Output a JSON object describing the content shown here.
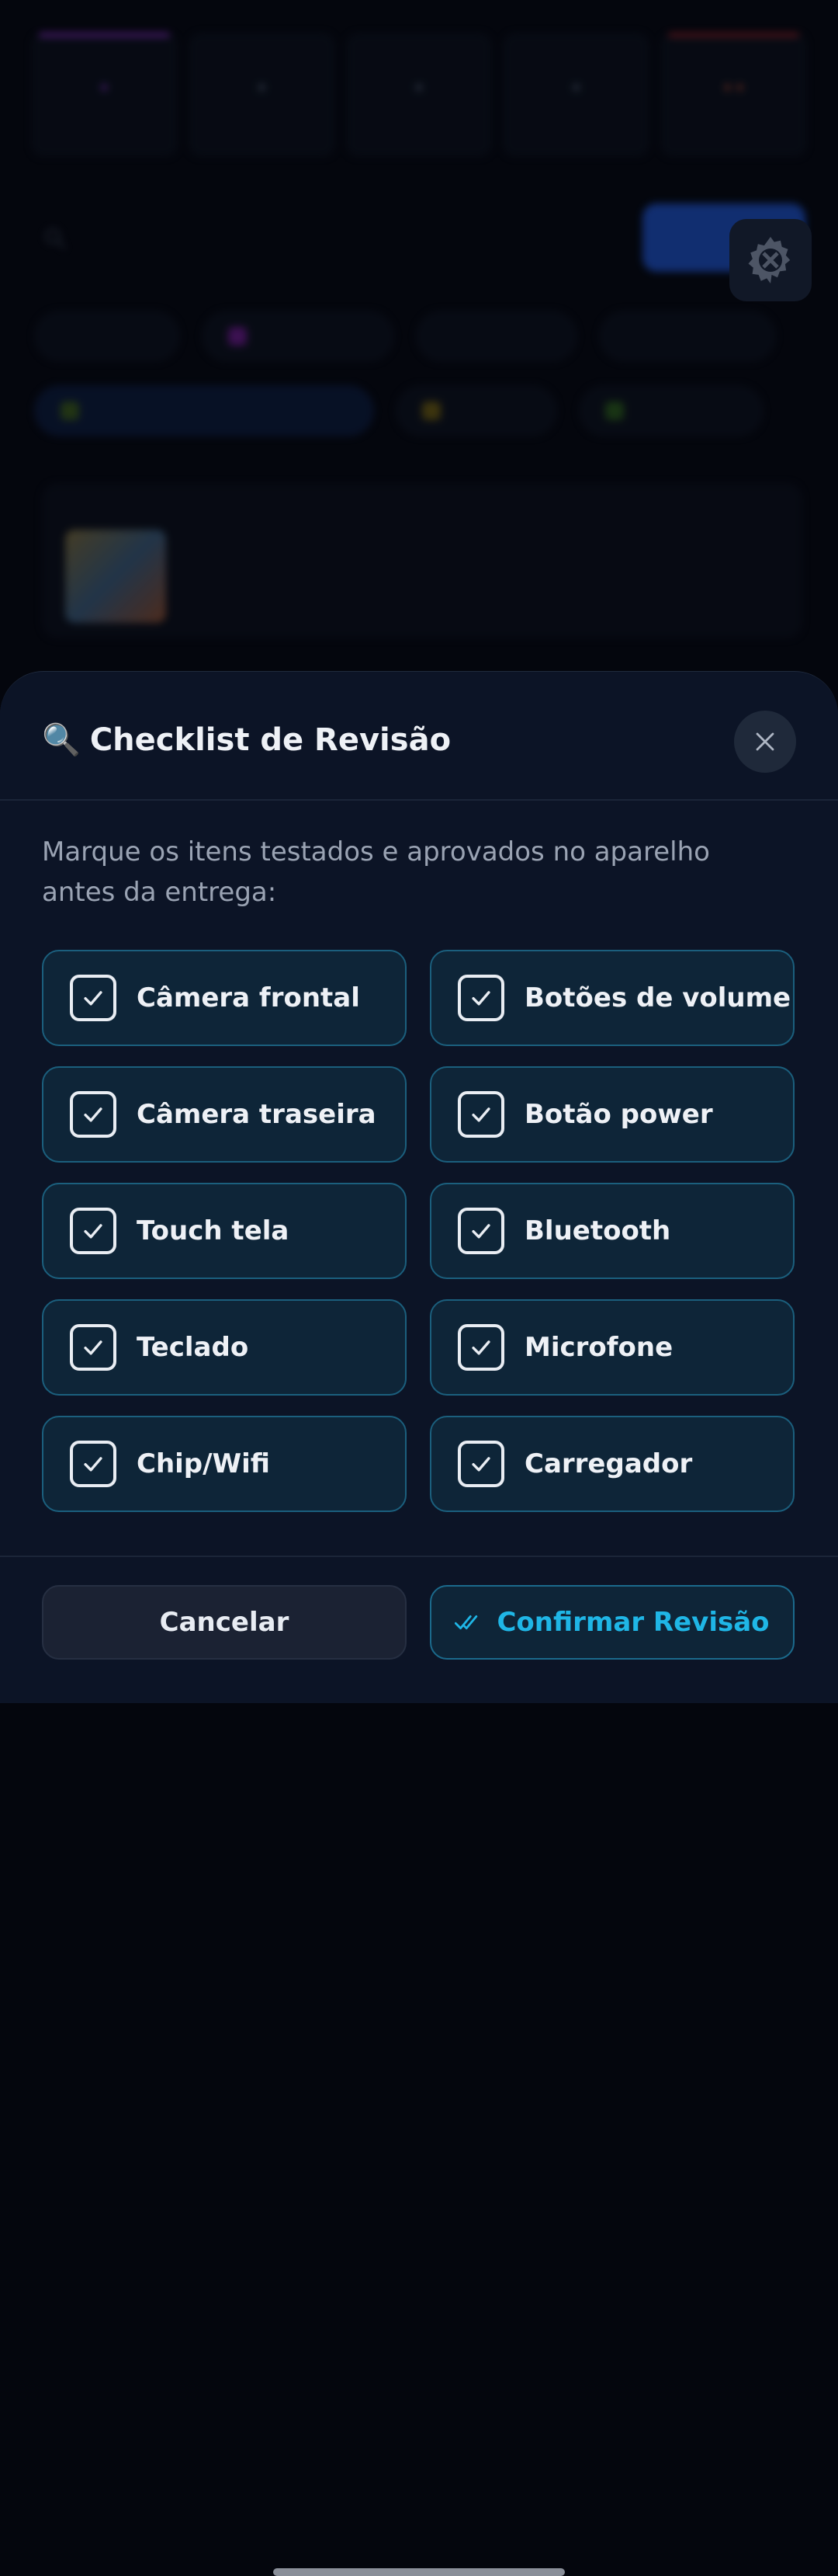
{
  "background": {
    "stats": [
      {
        "value": "",
        "label": "",
        "accent": "#9b2fd6"
      },
      {
        "value": "",
        "label": "",
        "accent": ""
      },
      {
        "value": "",
        "label": "",
        "accent": ""
      },
      {
        "value": "",
        "label": "",
        "accent": ""
      },
      {
        "value": "",
        "label": "",
        "accent": "#c0272d"
      }
    ],
    "search_placeholder": "",
    "filter_chips": [
      "",
      "",
      "",
      ""
    ],
    "status_chips": [
      "",
      "",
      ""
    ],
    "order_title": "",
    "gear_icon": "gear-tools-icon"
  },
  "modal": {
    "icon": "🔍",
    "title": "Checklist de Revisão",
    "close_icon": "close-icon",
    "description": "Marque os itens testados e aprovados no aparelho antes da entrega:",
    "items": [
      {
        "label": "Câmera frontal",
        "checked": true
      },
      {
        "label": "Botões de volume",
        "checked": true
      },
      {
        "label": "Câmera traseira",
        "checked": true
      },
      {
        "label": "Botão power",
        "checked": true
      },
      {
        "label": "Touch tela",
        "checked": true
      },
      {
        "label": "Bluetooth",
        "checked": true
      },
      {
        "label": "Teclado",
        "checked": true
      },
      {
        "label": "Microfone",
        "checked": true
      },
      {
        "label": "Chip/Wifi",
        "checked": true
      },
      {
        "label": "Carregador",
        "checked": true
      }
    ],
    "cancel_label": "Cancelar",
    "confirm_label": "Confirmar Revisão",
    "confirm_icon": "double-check-icon"
  },
  "colors": {
    "accent": "#1fb6e6",
    "sheet": "#0c1426",
    "item_bg": "#0e2538",
    "item_border": "#1b5f7d"
  }
}
